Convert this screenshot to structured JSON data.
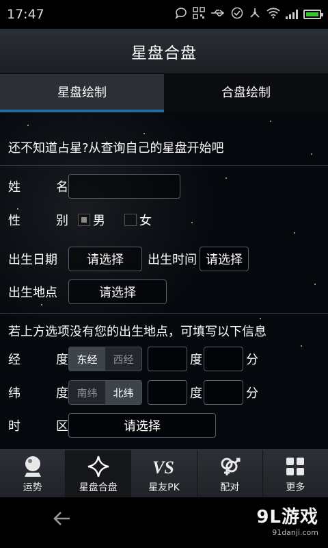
{
  "status": {
    "time": "17:47"
  },
  "header": {
    "title": "星盘合盘"
  },
  "tabs": [
    {
      "label": "星盘绘制",
      "active": true
    },
    {
      "label": "合盘绘制",
      "active": false
    }
  ],
  "form": {
    "intro": "还不知道占星?从查询自己的星盘开始吧",
    "name": {
      "label_a": "姓",
      "label_b": "名",
      "value": ""
    },
    "gender": {
      "label_a": "性",
      "label_b": "别",
      "male": "男",
      "female": "女",
      "selected": "男"
    },
    "birth_date": {
      "label": "出生日期",
      "value": "请选择"
    },
    "birth_time": {
      "label": "出生时间",
      "value": "请选择"
    },
    "birth_place": {
      "label": "出生地点",
      "value": "请选择"
    },
    "note": "若上方选项没有您的出生地点，可填写以下信息",
    "longitude": {
      "label_a": "经",
      "label_b": "度",
      "east": "东经",
      "west": "西经",
      "selected": "东经",
      "deg_unit": "度",
      "min_unit": "分",
      "deg": "",
      "min": ""
    },
    "latitude": {
      "label_a": "纬",
      "label_b": "度",
      "south": "南纬",
      "north": "北纬",
      "selected": "北纬",
      "deg_unit": "度",
      "min_unit": "分",
      "deg": "",
      "min": ""
    },
    "timezone": {
      "label_a": "时",
      "label_b": "区",
      "value": "请选择"
    }
  },
  "bottom_nav": [
    {
      "label": "运势",
      "icon": "crystal-ball-icon",
      "active": false
    },
    {
      "label": "星盘合盘",
      "icon": "star-icon",
      "active": true
    },
    {
      "label": "星友PK",
      "icon": "vs-icon",
      "active": false
    },
    {
      "label": "配对",
      "icon": "gender-pair-icon",
      "active": false
    },
    {
      "label": "更多",
      "icon": "grid-icon",
      "active": false
    }
  ],
  "watermark": {
    "main": "9L游戏",
    "sub": "91danji.com"
  },
  "colors": {
    "accent": "#1f6f9e",
    "checkbox_fill": "#888888",
    "battery": "#34c733"
  }
}
